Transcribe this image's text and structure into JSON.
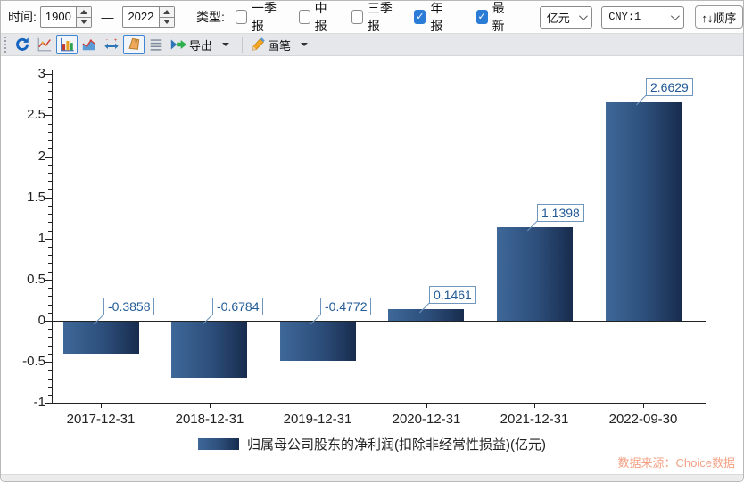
{
  "toolbar_time": {
    "time_label": "时间:",
    "start_value": "1900",
    "range_dash": "—",
    "end_value": "2022",
    "type_label": "类型:",
    "checkboxes": [
      {
        "label": "一季报",
        "checked": false
      },
      {
        "label": "中报",
        "checked": false
      },
      {
        "label": "三季报",
        "checked": false
      },
      {
        "label": "年报",
        "checked": true
      },
      {
        "label": "最新",
        "checked": true
      }
    ],
    "unit_select_value": "亿元",
    "currency_select_value": "CNY:1",
    "order_button_label": "↑↓顺序"
  },
  "toolbar_icons": {
    "items": [
      {
        "name": "refresh-icon",
        "selected": false
      },
      {
        "name": "line-chart-icon",
        "selected": false
      },
      {
        "name": "bar-chart-icon",
        "selected": true
      },
      {
        "name": "area-chart-icon",
        "selected": false
      },
      {
        "name": "axis-range-icon",
        "selected": false
      },
      {
        "name": "tag-icon",
        "selected": true
      },
      {
        "name": "list-icon",
        "selected": false
      }
    ],
    "export_label": "导出",
    "brush_label": "画笔"
  },
  "chart_data": {
    "type": "bar",
    "categories": [
      "2017-12-31",
      "2018-12-31",
      "2019-12-31",
      "2020-12-31",
      "2021-12-31",
      "2022-09-30"
    ],
    "values": [
      -0.3858,
      -0.6784,
      -0.4772,
      0.1461,
      1.1398,
      2.6629
    ],
    "value_labels": [
      "-0.3858",
      "-0.6784",
      "-0.4772",
      "0.1461",
      "1.1398",
      "2.6629"
    ],
    "legend": "归属母公司股东的净利润(扣除非经常性损益)(亿元)",
    "ylim": [
      -1,
      3
    ],
    "ytick_step": 0.5,
    "ytick_labels": [
      "3",
      "2.5",
      "2",
      "1.5",
      "1",
      "0.5",
      "0",
      "-0.5",
      "-1"
    ],
    "minor_tick_step": 0.1,
    "grid": false,
    "legend_position": "bottom",
    "bar_gradient": [
      "#3e6899",
      "#2c4d79",
      "#182c4e"
    ],
    "label_border_color": "#7096bd",
    "label_text_color": "#215a96"
  },
  "footer": {
    "source": "数据来源：Choice数据"
  }
}
